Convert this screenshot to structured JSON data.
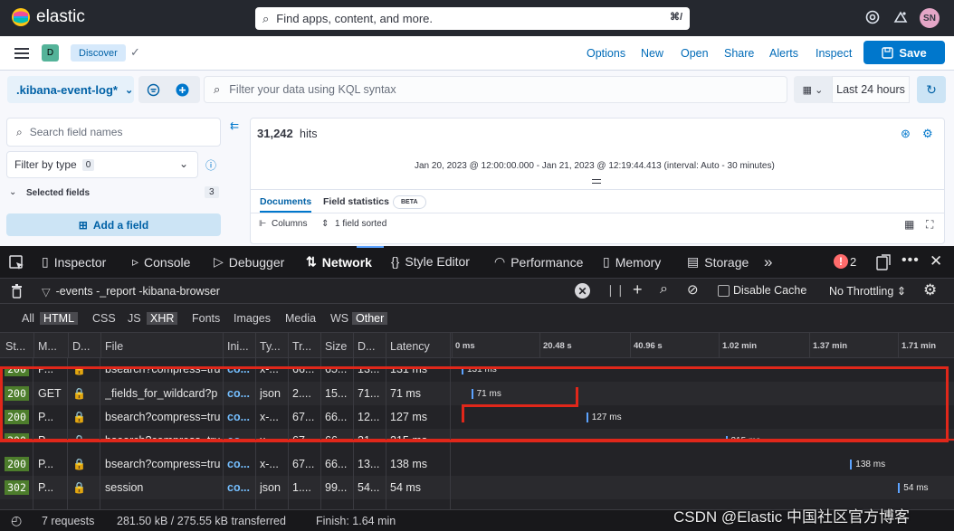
{
  "kibana": {
    "brand": "elastic",
    "search_placeholder": "Find apps, content, and more.",
    "search_shortcut": "⌘/",
    "avatar": "SN",
    "space_badge": "D",
    "app_badge": "Discover",
    "nav": {
      "options": "Options",
      "new": "New",
      "open": "Open",
      "share": "Share",
      "alerts": "Alerts",
      "inspect": "Inspect",
      "save": "Save"
    },
    "data_view": ".kibana-event-log*",
    "kql_placeholder": "Filter your data using KQL syntax",
    "time_range": "Last 24 hours",
    "field_search_placeholder": "Search field names",
    "filter_type_label": "Filter by type",
    "filter_type_count": "0",
    "selected_fields_label": "Selected fields",
    "selected_fields_count": "3",
    "add_field": "Add a field",
    "hits_count": "31,242",
    "hits_label": "hits",
    "time_caption": "Jan 20, 2023 @ 12:00:00.000 - Jan 21, 2023 @ 12:19:44.413 (interval: Auto - 30 minutes)",
    "tab_documents": "Documents",
    "tab_field_statistics": "Field statistics",
    "beta": "BETA",
    "columns": "Columns",
    "sorted": "1 field sorted"
  },
  "devtools": {
    "tabs": [
      "Inspector",
      "Console",
      "Debugger",
      "Network",
      "Style Editor",
      "Performance",
      "Memory",
      "Storage"
    ],
    "error_count": "2",
    "filter_text": "-events -_report -kibana-browser",
    "disable_cache": "Disable Cache",
    "throttling": "No Throttling ⇕",
    "type_filters": [
      "All",
      "HTML",
      "CSS",
      "JS",
      "XHR",
      "Fonts",
      "Images",
      "Media",
      "WS",
      "Other"
    ],
    "columns": [
      "St...",
      "M...",
      "D...",
      "File",
      "Ini...",
      "Ty...",
      "Tr...",
      "Size",
      "D...",
      "Latency"
    ],
    "timeline_ticks": [
      "0 ms",
      "20.48 s",
      "40.96 s",
      "1.02 min",
      "1.37 min",
      "1.71 min"
    ],
    "rows": [
      {
        "status": "200",
        "method": "P...",
        "file": "bsearch?compress=tru",
        "initiator": "co...",
        "type": "x-...",
        "transferred": "66...",
        "size": "65...",
        "duration": "13...",
        "latency": "131 ms",
        "bar_label": "131 ms",
        "bar_start": 0.0,
        "hidden": true
      },
      {
        "status": "200",
        "method": "GET",
        "file": "_fields_for_wildcard?p",
        "initiator": "co...",
        "type": "json",
        "transferred": "2....",
        "size": "15...",
        "duration": "71...",
        "latency": "71 ms",
        "bar_label": "71 ms",
        "bar_start": 0.02
      },
      {
        "status": "200",
        "method": "P...",
        "file": "bsearch?compress=tru",
        "initiator": "co...",
        "type": "x-...",
        "transferred": "67...",
        "size": "66...",
        "duration": "12...",
        "latency": "127 ms",
        "bar_label": "127 ms",
        "bar_start": 0.26
      },
      {
        "status": "200",
        "method": "P...",
        "file": "bsearch?compress=tru",
        "initiator": "co...",
        "type": "x-...",
        "transferred": "67...",
        "size": "66...",
        "duration": "21...",
        "latency": "215 ms",
        "bar_label": "215 ms",
        "bar_start": 0.55,
        "struck": true
      },
      {
        "status": "200",
        "method": "P...",
        "file": "bsearch?compress=tru",
        "initiator": "co...",
        "type": "x-...",
        "transferred": "67...",
        "size": "66...",
        "duration": "13...",
        "latency": "138 ms",
        "bar_label": "138 ms",
        "bar_start": 0.81
      },
      {
        "status": "302",
        "method": "P...",
        "file": "session",
        "initiator": "co...",
        "type": "json",
        "transferred": "1....",
        "size": "99...",
        "duration": "54...",
        "latency": "54 ms",
        "bar_label": "54 ms",
        "bar_start": 0.91
      }
    ],
    "summary": {
      "requests": "7 requests",
      "transferred": "281.50 kB / 275.55 kB transferred",
      "finish": "Finish: 1.64 min"
    }
  },
  "watermark": "CSDN @Elastic 中国社区官方博客",
  "colors": {
    "accent": "#0077cc",
    "devtools_bg": "#232327",
    "status_ok": "#4d7d2c",
    "highlight_box": "#e0271a"
  }
}
